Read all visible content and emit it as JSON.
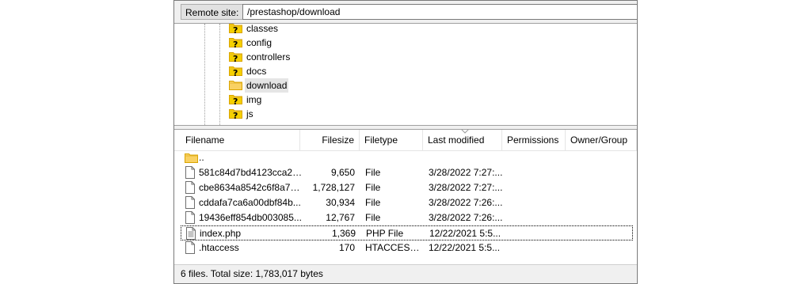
{
  "remote_site": {
    "label": "Remote site:",
    "path": "/prestashop/download"
  },
  "tree": {
    "items": [
      {
        "label": "classes",
        "unknown": true
      },
      {
        "label": "config",
        "unknown": true
      },
      {
        "label": "controllers",
        "unknown": true
      },
      {
        "label": "docs",
        "unknown": true
      },
      {
        "label": "download",
        "unknown": false,
        "selected": true
      },
      {
        "label": "img",
        "unknown": true
      },
      {
        "label": "js",
        "unknown": true
      }
    ]
  },
  "list": {
    "columns": [
      "Filename",
      "Filesize",
      "Filetype",
      "Last modified",
      "Permissions",
      "Owner/Group"
    ],
    "rows": [
      {
        "name": "..",
        "size": "",
        "type": "",
        "modified": "",
        "kind": "folder"
      },
      {
        "name": "581c84d7bd4123cca20...",
        "size": "9,650",
        "type": "File",
        "modified": "3/28/2022 7:27:...",
        "kind": "file"
      },
      {
        "name": "cbe8634a8542c6f8a79...",
        "size": "1,728,127",
        "type": "File",
        "modified": "3/28/2022 7:27:...",
        "kind": "file"
      },
      {
        "name": "cddafa7ca6a00dbf84b...",
        "size": "30,934",
        "type": "File",
        "modified": "3/28/2022 7:26:...",
        "kind": "file"
      },
      {
        "name": "19436eff854db003085...",
        "size": "12,767",
        "type": "File",
        "modified": "3/28/2022 7:26:...",
        "kind": "file"
      },
      {
        "name": "index.php",
        "size": "1,369",
        "type": "PHP File",
        "modified": "12/22/2021 5:5...",
        "kind": "php"
      },
      {
        "name": ".htaccess",
        "size": "170",
        "type": "HTACCESS ...",
        "modified": "12/22/2021 5:5...",
        "kind": "file"
      }
    ]
  },
  "status": {
    "text": "6 files. Total size: 1,783,017 bytes"
  },
  "colors": {
    "folder": "#f9d162",
    "unknown_badge": "#f5d000"
  },
  "icons": {
    "folder": "folder-icon",
    "unknown": "unknown-folder-icon",
    "file": "file-icon",
    "php": "php-file-icon"
  }
}
